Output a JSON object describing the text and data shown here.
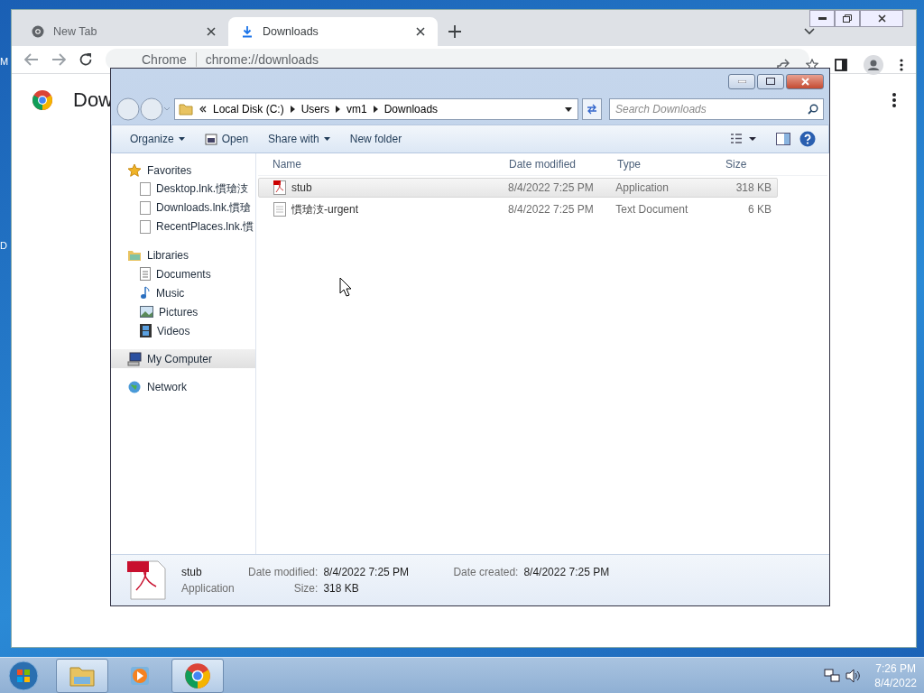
{
  "desktop": {
    "icon_labels": [
      "M",
      "D"
    ]
  },
  "browser": {
    "tabs": [
      {
        "label": "New Tab",
        "selected": false
      },
      {
        "label": "Downloads",
        "selected": true
      }
    ],
    "address": {
      "site": "Chrome",
      "url": "chrome://downloads"
    },
    "page_title": "Dow"
  },
  "explorer": {
    "breadcrumb": [
      "Local Disk (C:)",
      "Users",
      "vm1",
      "Downloads"
    ],
    "search": {
      "placeholder": "Search Downloads"
    },
    "toolbar": [
      {
        "label": "Organize",
        "kind": "menu"
      },
      {
        "label": "Open",
        "kind": "open"
      },
      {
        "label": "Share with",
        "kind": "menu"
      },
      {
        "label": "New folder",
        "kind": "plain"
      }
    ],
    "nav": [
      {
        "label": "Favorites",
        "kind": "favorites",
        "selected": false,
        "children": [
          {
            "label": "Desktop.lnk.慣瑲汥",
            "kind": "file",
            "selected": false
          },
          {
            "label": "Downloads.lnk.慣瑲",
            "kind": "file",
            "selected": false
          },
          {
            "label": "RecentPlaces.lnk.慣",
            "kind": "file",
            "selected": false
          }
        ]
      },
      {
        "label": "Libraries",
        "kind": "libraries",
        "selected": false,
        "children": [
          {
            "label": "Documents",
            "kind": "documents",
            "selected": false
          },
          {
            "label": "Music",
            "kind": "music",
            "selected": false
          },
          {
            "label": "Pictures",
            "kind": "pictures",
            "selected": false
          },
          {
            "label": "Videos",
            "kind": "videos",
            "selected": false
          }
        ]
      },
      {
        "label": "My Computer",
        "kind": "computer",
        "selected": true
      },
      {
        "label": "Network",
        "kind": "network",
        "selected": false
      }
    ],
    "columns": [
      "Name",
      "Date modified",
      "Type",
      "Size"
    ],
    "files": [
      {
        "name": "stub",
        "date": "8/4/2022 7:25 PM",
        "type": "Application",
        "size": "318 KB",
        "kind": "pdf",
        "selected": true
      },
      {
        "name": "慣瑲汥-urgent",
        "date": "8/4/2022 7:25 PM",
        "type": "Text Document",
        "size": "6 KB",
        "kind": "text",
        "selected": false
      }
    ],
    "details": {
      "name": "stub",
      "type": "Application",
      "fields": [
        {
          "label": "Date modified:",
          "value": "8/4/2022 7:25 PM"
        },
        {
          "label": "Size:",
          "value": "318 KB"
        },
        {
          "label": "Date created:",
          "value": "8/4/2022 7:25 PM"
        }
      ]
    }
  },
  "taskbar": {
    "apps": [
      {
        "kind": "explorer",
        "active": true
      },
      {
        "kind": "media",
        "active": false
      },
      {
        "kind": "chrome",
        "active": true
      }
    ],
    "time": "7:26 PM",
    "date": "8/4/2022"
  }
}
